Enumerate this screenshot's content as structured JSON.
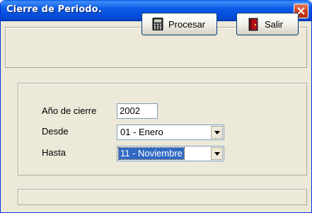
{
  "window": {
    "title": "Cierre de Periodo."
  },
  "toolbar": {
    "procesar_label": "Procesar",
    "procesar_icon": "calculator-icon",
    "salir_label": "Salir",
    "salir_icon": "exit-door-icon"
  },
  "form": {
    "year_label": "Año de cierre",
    "year_value": "2002",
    "from_label": "Desde",
    "from_value": "01 - Enero",
    "to_label": "Hasta",
    "to_value": "11 - Noviembre"
  },
  "status": {
    "text": ""
  },
  "colors": {
    "titlebar": "#0548d4",
    "window_bg": "#ece9d8",
    "selection": "#316ac5",
    "close_button": "#c93a14"
  }
}
